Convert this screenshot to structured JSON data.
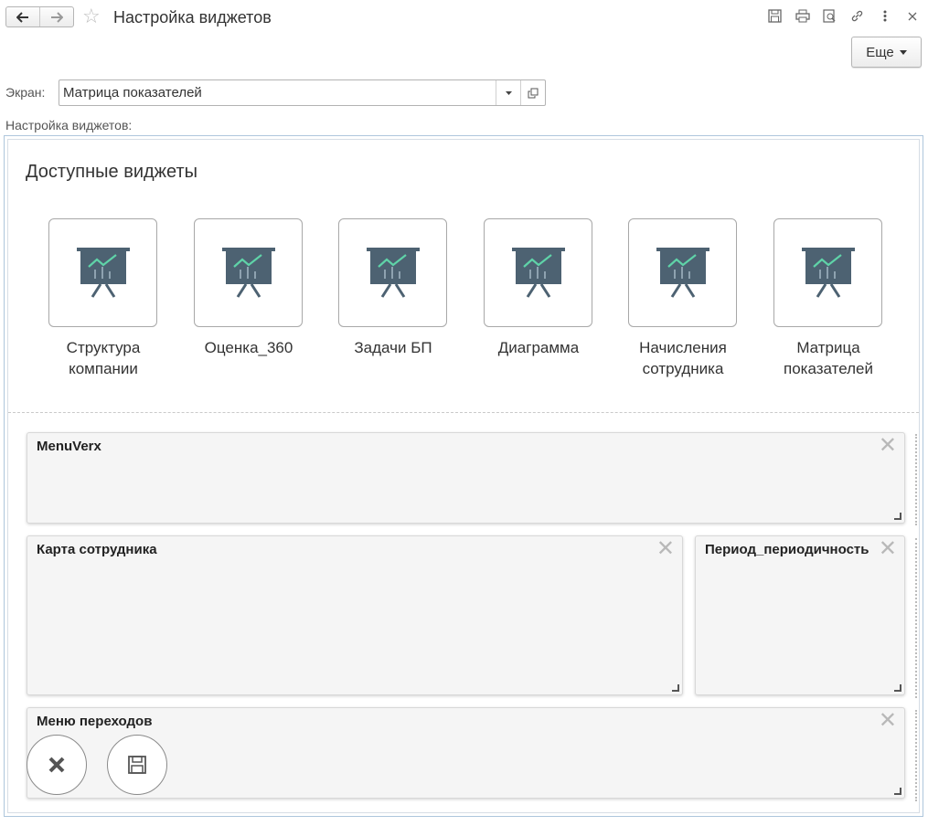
{
  "header": {
    "title": "Настройка виджетов",
    "back_icon": "arrow-left-icon",
    "forward_icon": "arrow-right-icon",
    "favorite_icon": "star-icon",
    "tools": [
      "save-icon",
      "print-icon",
      "preview-icon",
      "link-icon",
      "more-vert-icon",
      "close-icon"
    ],
    "more_button": "Еще"
  },
  "screen": {
    "label": "Экран:",
    "value": "Матрица показателей"
  },
  "settings_label": "Настройка виджетов:",
  "available": {
    "title": "Доступные виджеты",
    "widgets": [
      {
        "label": "Структура компании"
      },
      {
        "label": "Оценка_360"
      },
      {
        "label": "Задачи БП"
      },
      {
        "label": "Диаграмма"
      },
      {
        "label": "Начисления сотрудника"
      },
      {
        "label": "Матрица показателей"
      }
    ]
  },
  "panels": {
    "menu_verx": "MenuVerx",
    "karta": "Карта сотрудника",
    "period": "Период_периодичность",
    "menu_perehodov": "Меню переходов"
  },
  "colors": {
    "icon_board": "#4d6272",
    "icon_chart": "#5fd3a8",
    "frame_border": "#aec6dc"
  }
}
